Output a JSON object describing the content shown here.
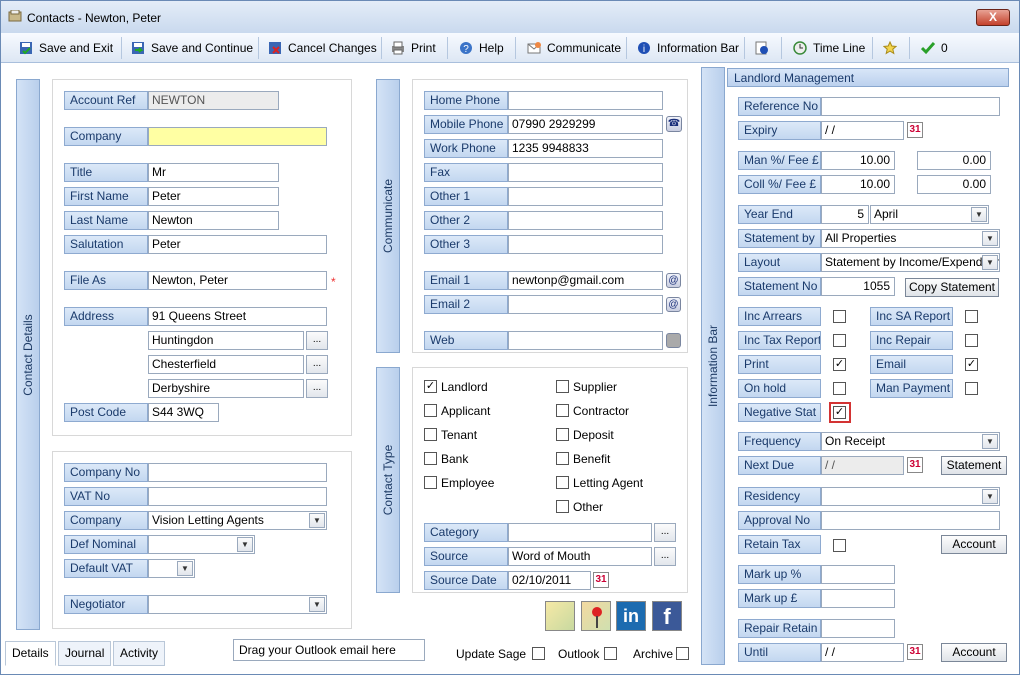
{
  "window": {
    "title": "Contacts  - Newton, Peter",
    "close": "X"
  },
  "toolbar": {
    "save_exit": "Save and Exit",
    "save_continue": "Save and Continue",
    "cancel": "Cancel Changes",
    "print": "Print",
    "help": "Help",
    "communicate": "Communicate",
    "info_bar": "Information Bar",
    "time_line": "Time Line",
    "count": "0"
  },
  "tabs_vertical": {
    "contact_details": "Contact Details",
    "communicate": "Communicate",
    "contact_type": "Contact Type",
    "information_bar": "Information Bar"
  },
  "details": {
    "account_ref": {
      "label": "Account Ref",
      "value": "NEWTON"
    },
    "company": {
      "label": "Company",
      "value": ""
    },
    "title": {
      "label": "Title",
      "value": "Mr"
    },
    "first_name": {
      "label": "First Name",
      "value": "Peter"
    },
    "last_name": {
      "label": "Last Name",
      "value": "Newton"
    },
    "salutation": {
      "label": "Salutation",
      "value": "Peter"
    },
    "file_as": {
      "label": "File As",
      "value": "Newton, Peter"
    },
    "address": {
      "label": "Address",
      "line1": "91 Queens Street",
      "line2": "Huntingdon",
      "line3": "Chesterfield",
      "line4": "Derbyshire"
    },
    "post_code": {
      "label": "Post Code",
      "value": "S44 3WQ"
    },
    "required_mark": "*",
    "ellipsis": "..."
  },
  "company_section": {
    "company_no": {
      "label": "Company No",
      "value": ""
    },
    "vat_no": {
      "label": "VAT No",
      "value": ""
    },
    "company": {
      "label": "Company",
      "value": "Vision Letting Agents"
    },
    "def_nominal": {
      "label": "Def Nominal",
      "value": ""
    },
    "default_vat": {
      "label": "Default VAT",
      "value": ""
    },
    "negotiator": {
      "label": "Negotiator",
      "value": ""
    }
  },
  "communicate": {
    "home_phone": {
      "label": "Home Phone",
      "value": ""
    },
    "mobile_phone": {
      "label": "Mobile Phone",
      "value": "07990 2929299"
    },
    "work_phone": {
      "label": "Work Phone",
      "value": "1235 9948833"
    },
    "fax": {
      "label": "Fax",
      "value": ""
    },
    "other1": {
      "label": "Other 1",
      "value": ""
    },
    "other2": {
      "label": "Other 2",
      "value": ""
    },
    "other3": {
      "label": "Other 3",
      "value": ""
    },
    "email1": {
      "label": "Email 1",
      "value": "newtonp@gmail.com"
    },
    "email2": {
      "label": "Email 2",
      "value": ""
    },
    "web": {
      "label": "Web",
      "value": ""
    }
  },
  "contact_type": {
    "landlord": {
      "label": "Landlord",
      "checked": "✓"
    },
    "applicant": {
      "label": "Applicant"
    },
    "tenant": {
      "label": "Tenant"
    },
    "bank": {
      "label": "Bank"
    },
    "employee": {
      "label": "Employee"
    },
    "supplier": {
      "label": "Supplier"
    },
    "contractor": {
      "label": "Contractor"
    },
    "deposit": {
      "label": "Deposit"
    },
    "benefit": {
      "label": "Benefit"
    },
    "letting_agent": {
      "label": "Letting Agent"
    },
    "other": {
      "label": "Other"
    },
    "category": {
      "label": "Category",
      "value": ""
    },
    "source": {
      "label": "Source",
      "value": "Word of Mouth"
    },
    "source_date": {
      "label": "Source Date",
      "value": "02/10/2011"
    }
  },
  "landlord": {
    "header": "Landlord Management",
    "reference_no": {
      "label": "Reference No",
      "value": ""
    },
    "expiry": {
      "label": "Expiry",
      "value": " / /"
    },
    "man_fee": {
      "label": "Man %/ Fee £",
      "value": "10.00",
      "value2": "0.00"
    },
    "coll_fee": {
      "label": "Coll %/ Fee £",
      "value": "10.00",
      "value2": "0.00"
    },
    "year_end": {
      "label": "Year End",
      "day": "5",
      "month": "April"
    },
    "statement_by": {
      "label": "Statement by",
      "value": "All Properties"
    },
    "layout": {
      "label": "Layout",
      "value": "Statement by Income/Expenditure"
    },
    "statement_no": {
      "label": "Statement No",
      "value": "1055",
      "button": "Copy Statement"
    },
    "inc_arrears": {
      "label": "Inc Arrears"
    },
    "inc_sa_report": {
      "label": "Inc SA Report"
    },
    "inc_tax_report": {
      "label": "Inc Tax Report"
    },
    "inc_repair": {
      "label": "Inc Repair"
    },
    "print": {
      "label": "Print",
      "checked": "✓"
    },
    "email": {
      "label": "Email",
      "checked": "✓"
    },
    "on_hold": {
      "label": "On hold"
    },
    "man_payment": {
      "label": "Man Payment"
    },
    "negative_stat": {
      "label": "Negative Stat",
      "checked": "✓"
    },
    "frequency": {
      "label": "Frequency",
      "value": "On Receipt"
    },
    "next_due": {
      "label": "Next Due",
      "value": " / /",
      "button": "Statement"
    },
    "residency": {
      "label": "Residency",
      "value": ""
    },
    "approval_no": {
      "label": "Approval No",
      "value": ""
    },
    "retain_tax": {
      "label": "Retain Tax",
      "button": "Account"
    },
    "mark_up_pct": {
      "label": "Mark up %",
      "value": ""
    },
    "mark_up_gbp": {
      "label": "Mark up £",
      "value": ""
    },
    "repair_retain": {
      "label": "Repair Retain",
      "value": ""
    },
    "until": {
      "label": "Until",
      "value": " / /",
      "button": "Account"
    }
  },
  "bottom": {
    "tab_details": "Details",
    "tab_journal": "Journal",
    "tab_activity": "Activity",
    "drop_area": "Drag your Outlook email here",
    "update_sage": "Update Sage",
    "outlook": "Outlook",
    "archive": "Archive"
  },
  "icons": {
    "cal": "31",
    "at": "@",
    "linkedin": "in",
    "facebook": "f",
    "dropdown": "▼",
    "phone": "☎"
  },
  "colors": {
    "label_bg": "#c3d7f0",
    "company_field": "#ffffa3",
    "highlight_border": "#d33333"
  }
}
